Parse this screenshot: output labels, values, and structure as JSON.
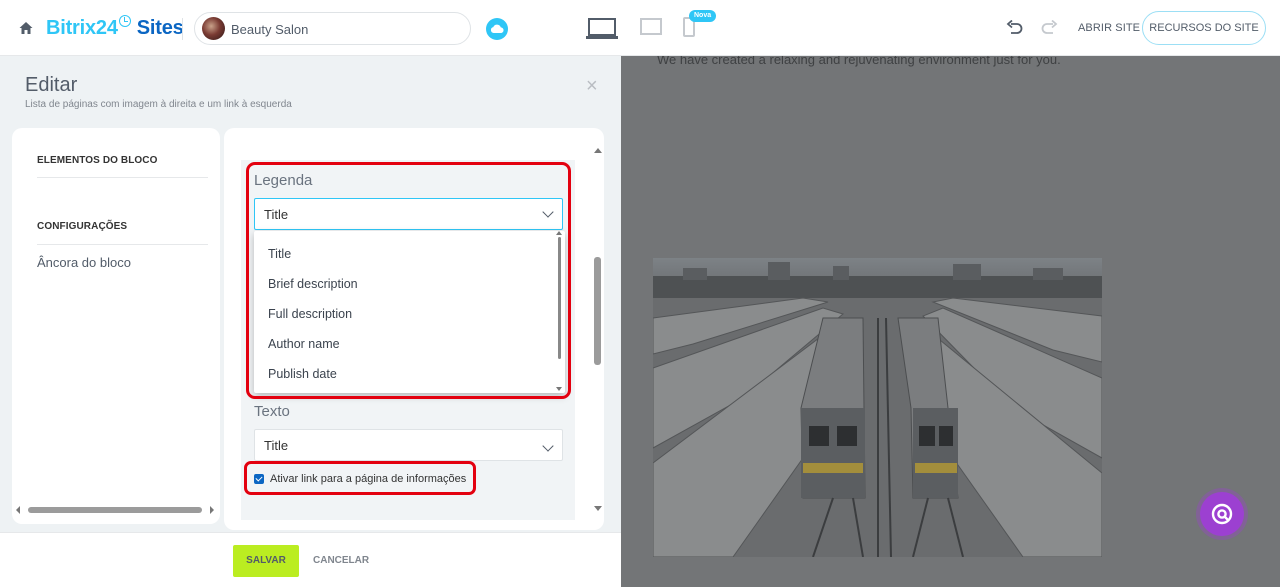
{
  "topbar": {
    "logo_brand": "Bitrix24",
    "logo_product": "Sites",
    "site_name": "Beauty Salon",
    "nova_badge": "Nova",
    "abrir_site": "ABRIR SITE",
    "recursos_site": "RECURSOS DO SITE"
  },
  "edit": {
    "title": "Editar",
    "subtitle": "Lista de páginas com imagem à direita e um link à esquerda",
    "nav": {
      "block_elements": "ELEMENTOS DO BLOCO",
      "settings": "CONFIGURAÇÕES",
      "anchor": "Âncora do bloco"
    },
    "legenda": {
      "label": "Legenda",
      "selected": "Title",
      "options": [
        "Title",
        "Brief description",
        "Full description",
        "Author name",
        "Publish date"
      ]
    },
    "texto": {
      "label": "Texto",
      "selected": "Title"
    },
    "checkbox": {
      "label": "Ativar link para a página de informações",
      "checked": true
    },
    "save": "SALVAR",
    "cancel": "CANCELAR"
  },
  "preview": {
    "text": "We have created a relaxing and rejuvenating environment just for you."
  },
  "colors": {
    "accent": "#2fc6f6",
    "brand_dark": "#0b66c3",
    "save_green": "#bbed21",
    "highlight_red": "#e3000f",
    "chat_purple": "#9c40d1"
  },
  "icons": [
    "home-icon",
    "clock-icon",
    "cloud-icon",
    "desktop-icon",
    "tablet-icon",
    "mobile-icon",
    "undo-icon",
    "redo-icon",
    "close-icon",
    "chevron-down-icon",
    "chat-icon"
  ]
}
